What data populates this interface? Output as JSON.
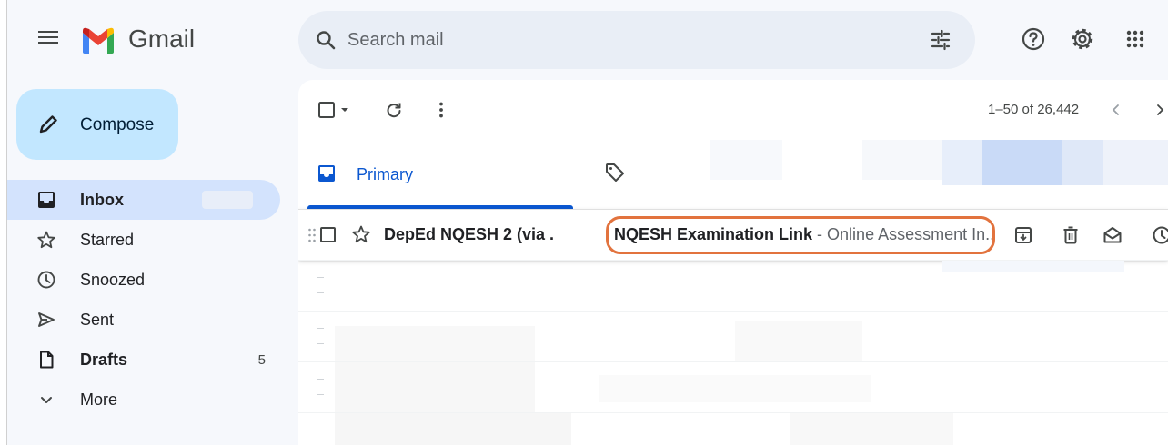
{
  "app": {
    "brand": "Gmail"
  },
  "search": {
    "placeholder": "Search mail"
  },
  "sidebar": {
    "compose_label": "Compose",
    "items": [
      {
        "label": "Inbox",
        "count": ""
      },
      {
        "label": "Starred",
        "count": ""
      },
      {
        "label": "Snoozed",
        "count": ""
      },
      {
        "label": "Sent",
        "count": ""
      },
      {
        "label": "Drafts",
        "count": "5"
      },
      {
        "label": "More",
        "count": ""
      }
    ]
  },
  "toolbar": {
    "pagination": "1–50 of 26,442"
  },
  "tabs": {
    "primary": "Primary"
  },
  "email": {
    "sender": "DepEd NQESH 2 (via .",
    "subject": "NQESH Examination Link",
    "separator": " - ",
    "snippet": "Online Assessment In..."
  },
  "colors": {
    "accent": "#0b57d0",
    "compose_bg": "#c2e7ff",
    "active_nav_bg": "#d3e3fd",
    "highlight_outline": "#e2733e"
  }
}
